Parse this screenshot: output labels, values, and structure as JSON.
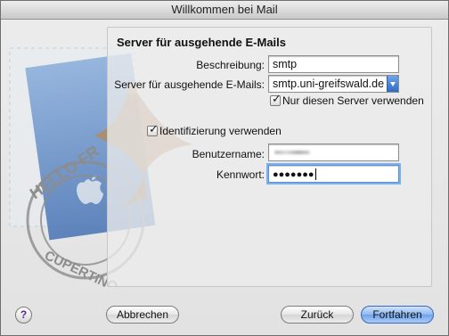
{
  "window": {
    "title": "Willkommen bei Mail"
  },
  "stamp": {
    "text_top": "HELLO FR",
    "text_bottom": "CUPERTINO CA"
  },
  "form": {
    "heading": "Server für ausgehende E-Mails",
    "description_label": "Beschreibung:",
    "description_value": "smtp",
    "server_label": "Server für ausgehende E-Mails:",
    "server_value": "smtp.uni-greifswald.de",
    "only_this_server_label": "Nur diesen Server verwenden",
    "only_this_server_checked": true,
    "auth_label": "Identifizierung verwenden",
    "auth_checked": true,
    "username_label": "Benutzername:",
    "password_label": "Kennwort:",
    "password_value": "●●●●●●●"
  },
  "buttons": {
    "help": "?",
    "cancel": "Abbrechen",
    "back": "Zurück",
    "continue": "Fortfahren"
  }
}
